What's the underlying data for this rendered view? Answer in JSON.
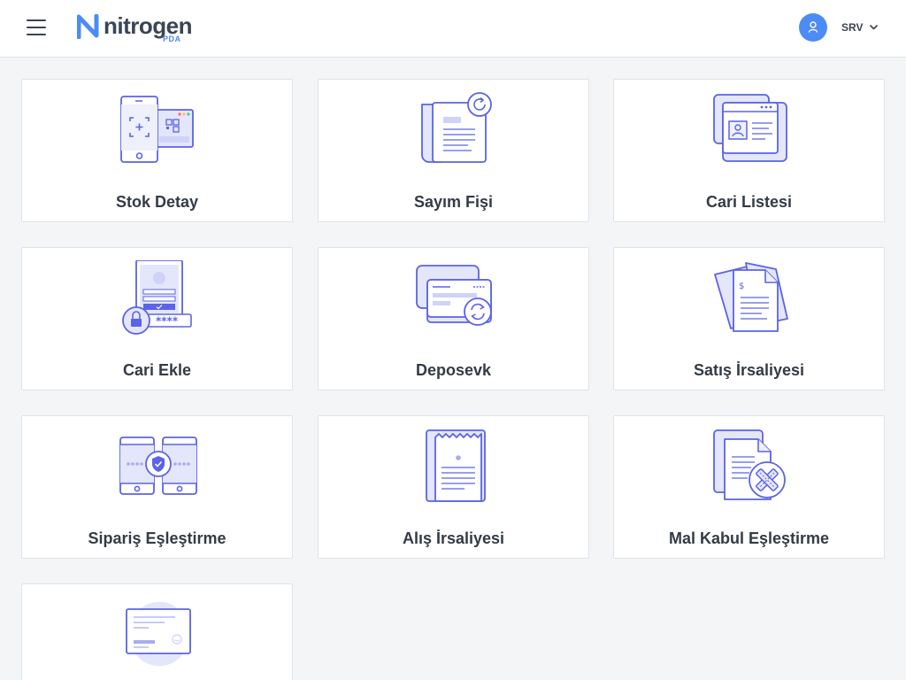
{
  "header": {
    "menu_icon": "hamburger-icon",
    "logo_text": "nitrogen",
    "logo_sub": "PDA",
    "user_icon": "user-icon",
    "user_name": "SRV",
    "chevron_icon": "chevron-down-icon",
    "accent_color": "#4d8bf5"
  },
  "menu": {
    "items": [
      {
        "label": "Stok Detay",
        "icon": "mobile-scan-icon"
      },
      {
        "label": "Sayım Fişi",
        "icon": "document-refresh-icon"
      },
      {
        "label": "Cari Listesi",
        "icon": "contact-cards-icon"
      },
      {
        "label": "Cari Ekle",
        "icon": "secure-form-icon"
      },
      {
        "label": "Deposevk",
        "icon": "card-transfer-icon"
      },
      {
        "label": "Satış İrsaliyesi",
        "icon": "invoice-documents-icon"
      },
      {
        "label": "Sipariş Eşleştirme",
        "icon": "device-sync-shield-icon"
      },
      {
        "label": "Alış İrsaliyesi",
        "icon": "receipt-icon"
      },
      {
        "label": "Mal Kabul Eşleştirme",
        "icon": "document-tools-icon"
      },
      {
        "label": "",
        "icon": "envelope-card-icon"
      }
    ]
  },
  "colors": {
    "icon_stroke": "#5b63e8",
    "icon_fill": "#e4e6fb",
    "text": "#333b46",
    "background": "#f4f5f7"
  }
}
